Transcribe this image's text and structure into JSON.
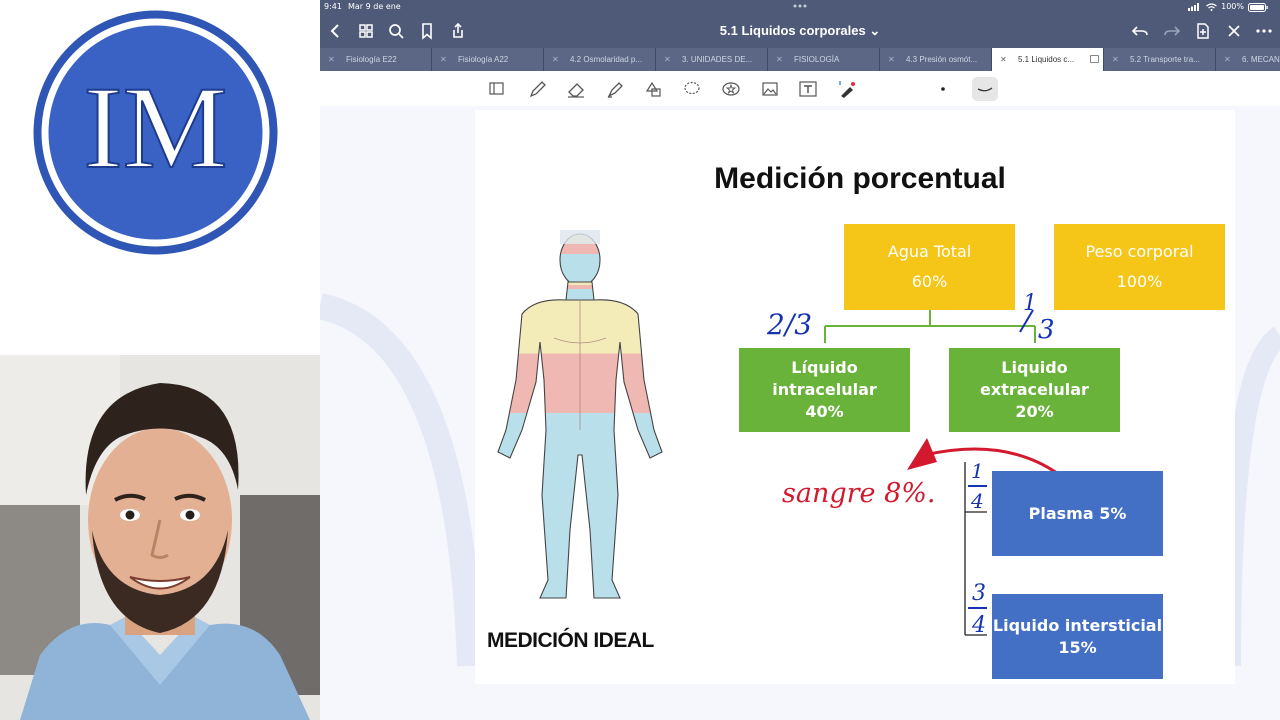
{
  "logo": {
    "letters": "IM",
    "ring_color": "#3a5dbb",
    "inner_color": "#2b4fae"
  },
  "statusbar": {
    "time": "9:41",
    "date": "Mar 9 de ene",
    "battery": "100%"
  },
  "navbar": {
    "title": "5.1 Liquidos corporales ⌄"
  },
  "tabs": [
    {
      "label": "Fisiología E22",
      "active": false
    },
    {
      "label": "Fisiología A22",
      "active": false
    },
    {
      "label": "4.2 Osmolaridad p...",
      "active": false
    },
    {
      "label": "3. UNIDADES DE...",
      "active": false
    },
    {
      "label": "FISIOLOGÍA",
      "active": false
    },
    {
      "label": "4.3 Presión osmót...",
      "active": false
    },
    {
      "label": "5.1 Liquidos c...",
      "active": true
    },
    {
      "label": "5.2 Transporte tra...",
      "active": false
    },
    {
      "label": "6. MECAN",
      "active": false
    }
  ],
  "toolbar": {
    "tools": [
      "reader-icon",
      "pen-icon",
      "eraser-icon",
      "highlighter-icon",
      "shapes-icon",
      "lasso-icon",
      "sticker-icon",
      "image-icon",
      "text-icon",
      "laser-pointer-icon",
      "dot-size-icon",
      "stroke-style-icon"
    ]
  },
  "slide": {
    "title": "Medición porcentual",
    "figure_label": "MEDICIÓN IDEAL",
    "boxes": {
      "agua_total": {
        "name": "Agua Total",
        "value": "60%"
      },
      "peso_corporal": {
        "name": "Peso corporal",
        "value": "100%"
      },
      "intracelular": {
        "name": "Líquido intracelular",
        "value": "40%"
      },
      "extracelular": {
        "name": "Liquido extracelular",
        "value": "20%"
      },
      "plasma": {
        "name": "Plasma 5%"
      },
      "intersticial": {
        "name": "Liquido intersticial",
        "value": "15%"
      }
    },
    "annotations": {
      "two_thirds": "2/3",
      "one_third_num": "1",
      "one_third_den": "3",
      "one_fourth_num": "1",
      "one_fourth_den": "4",
      "three_fourths_num": "3",
      "three_fourths_den": "4",
      "sangre": "sangre 8%."
    }
  },
  "colors": {
    "app_chrome": "#4e5a77",
    "yellow_box": "#f5c518",
    "green_box": "#69b33a",
    "blue_box": "#4370c4",
    "annotation_blue": "#1533b3",
    "annotation_red": "#d2192d"
  }
}
